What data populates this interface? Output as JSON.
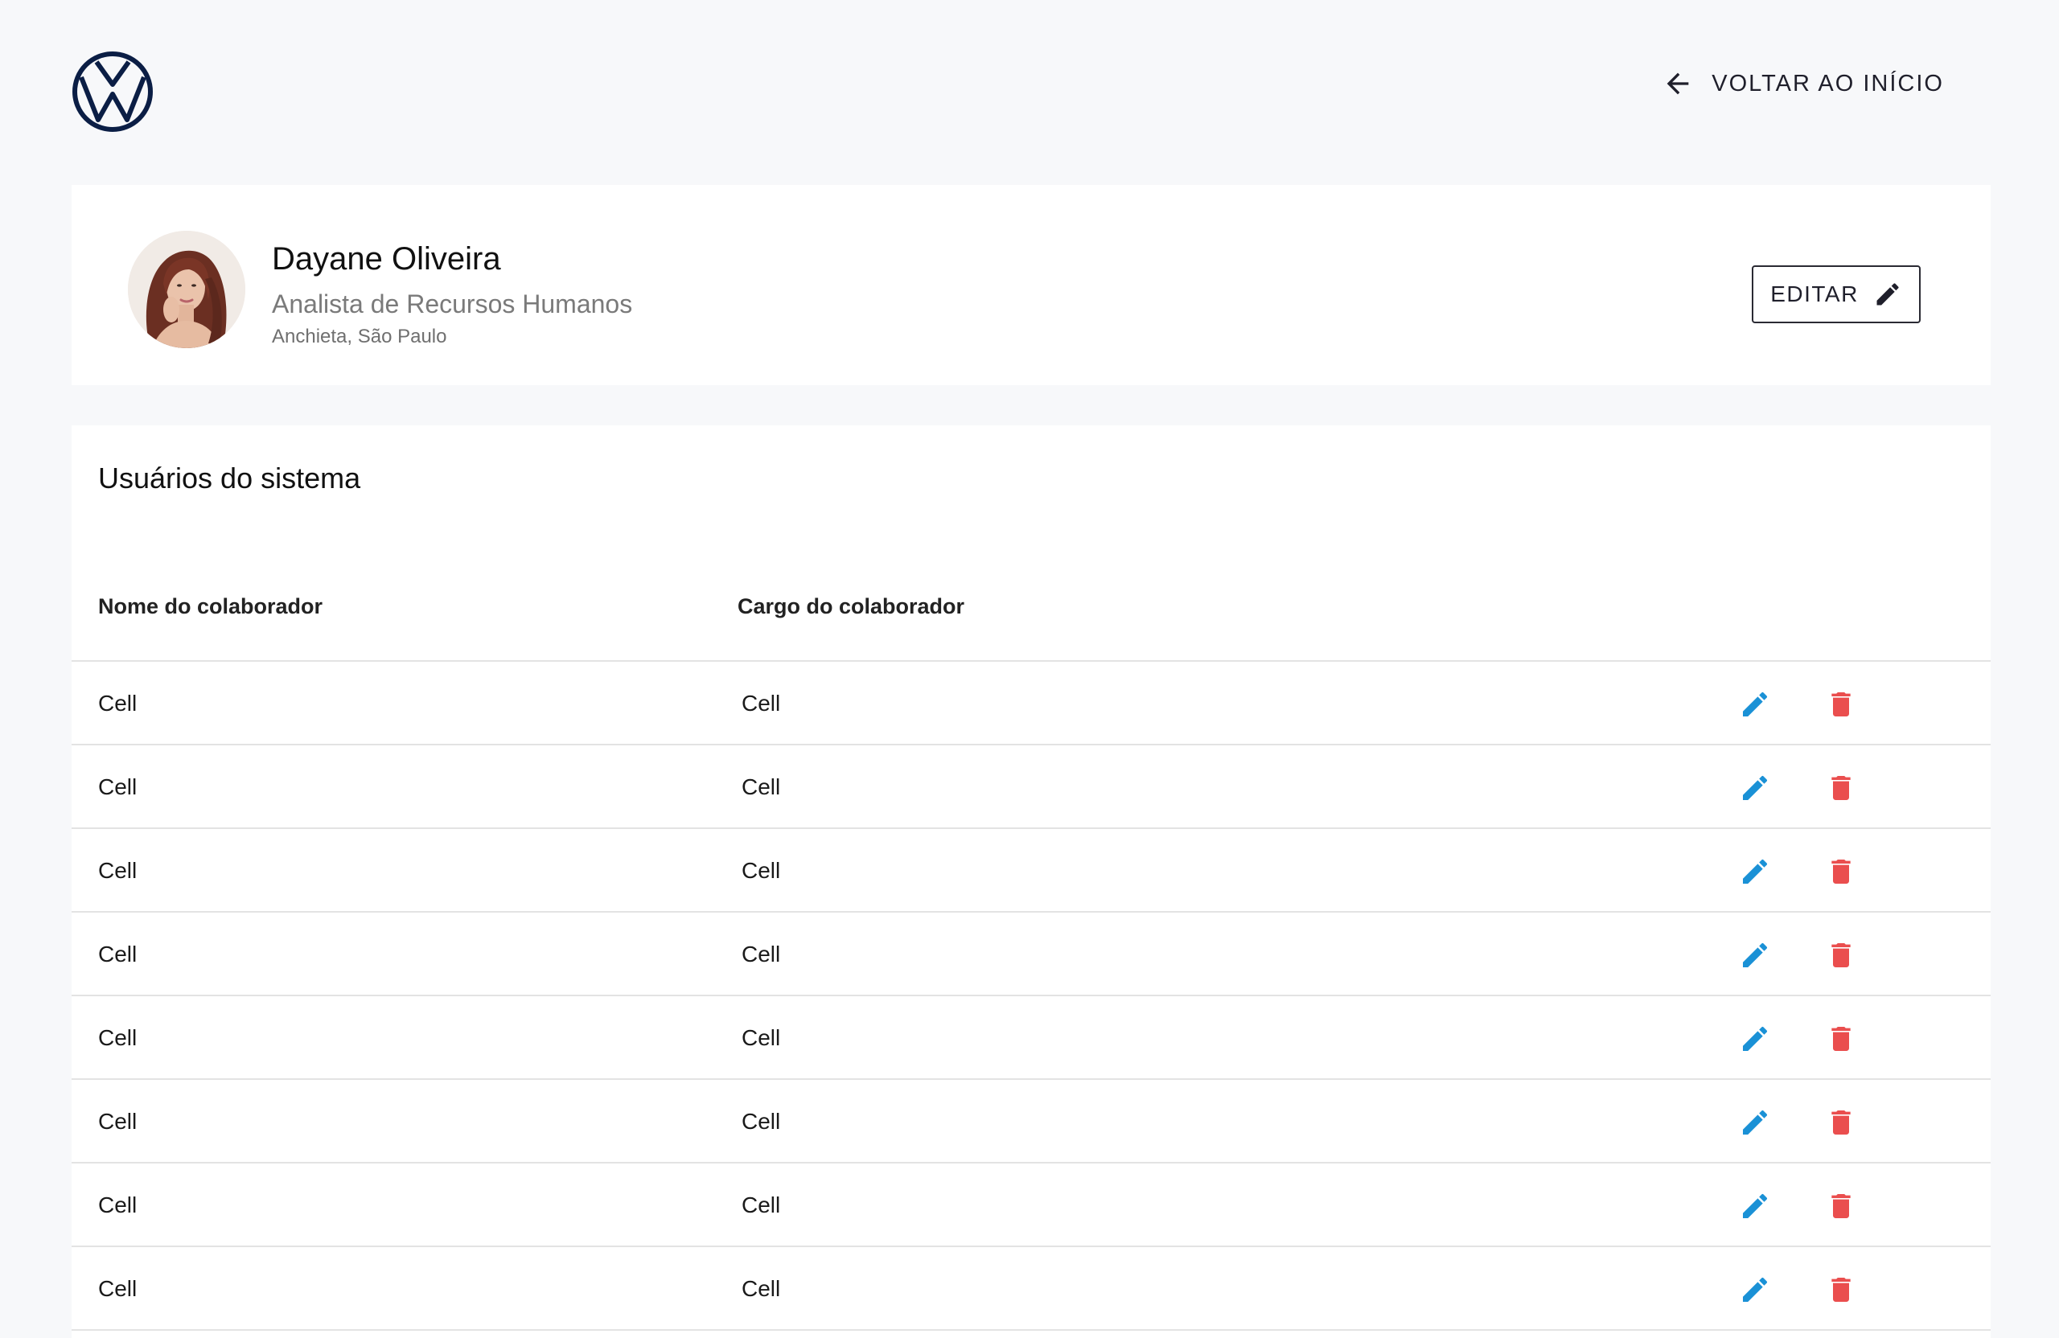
{
  "colors": {
    "background": "#f7f8fa",
    "card": "#ffffff",
    "brand_navy": "#0b1e45",
    "edit_icon": "#1a91d6",
    "delete_icon": "#ea4e4e",
    "muted_text": "#7a7a7a"
  },
  "header": {
    "logo_icon": "volkswagen-logo",
    "back_icon": "arrow-left-icon",
    "back_label": "VOLTAR AO INÍCIO"
  },
  "profile": {
    "avatar_icon": "user-avatar-photo",
    "name": "Dayane Oliveira",
    "role": "Analista de Recursos Humanos",
    "location": "Anchieta, São Paulo",
    "edit_label": "EDITAR",
    "edit_icon": "pencil-icon"
  },
  "users_panel": {
    "title": "Usuários do sistema",
    "columns": {
      "name": "Nome do colaborador",
      "role": "Cargo do colaborador"
    },
    "row_edit_icon": "pencil-icon",
    "row_delete_icon": "trash-icon",
    "rows": [
      {
        "name": "Cell",
        "role": "Cell"
      },
      {
        "name": "Cell",
        "role": "Cell"
      },
      {
        "name": "Cell",
        "role": "Cell"
      },
      {
        "name": "Cell",
        "role": "Cell"
      },
      {
        "name": "Cell",
        "role": "Cell"
      },
      {
        "name": "Cell",
        "role": "Cell"
      },
      {
        "name": "Cell",
        "role": "Cell"
      },
      {
        "name": "Cell",
        "role": "Cell"
      }
    ]
  }
}
